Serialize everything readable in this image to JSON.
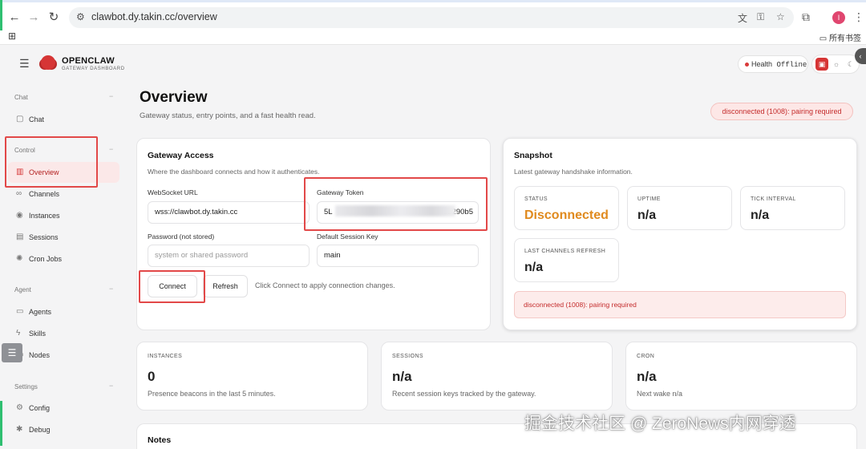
{
  "browser": {
    "url": "clawbot.dy.takin.cc/overview",
    "bookmark_folder": "所有书签",
    "profile_initial": "I"
  },
  "header": {
    "brand": "OPENCLAW",
    "brand_sub": "GATEWAY DASHBOARD",
    "health_label": "Health",
    "health_value": "Offline"
  },
  "sidebar": {
    "groups": [
      {
        "label": "Chat",
        "items": [
          {
            "label": "Chat",
            "icon": "chat-bubble-icon"
          }
        ]
      },
      {
        "label": "Control",
        "items": [
          {
            "label": "Overview",
            "icon": "bar-chart-icon",
            "active": true
          },
          {
            "label": "Channels",
            "icon": "link-icon"
          },
          {
            "label": "Instances",
            "icon": "radio-icon"
          },
          {
            "label": "Sessions",
            "icon": "document-icon"
          },
          {
            "label": "Cron Jobs",
            "icon": "loader-icon"
          }
        ]
      },
      {
        "label": "Agent",
        "items": [
          {
            "label": "Agents",
            "icon": "folder-icon"
          },
          {
            "label": "Skills",
            "icon": "bolt-icon"
          },
          {
            "label": "Nodes",
            "icon": "monitor-icon"
          }
        ]
      },
      {
        "label": "Settings",
        "items": [
          {
            "label": "Config",
            "icon": "gear-icon"
          },
          {
            "label": "Debug",
            "icon": "bug-icon"
          }
        ]
      }
    ]
  },
  "page": {
    "title": "Overview",
    "subtitle": "Gateway status, entry points, and a fast health read.",
    "status_pill": "disconnected (1008): pairing required"
  },
  "gateway": {
    "title": "Gateway Access",
    "subtitle": "Where the dashboard connects and how it authenticates.",
    "ws_label": "WebSocket URL",
    "ws_value": "wss://clawbot.dy.takin.cc",
    "token_label": "Gateway Token",
    "token_prefix": "5L",
    "token_suffix": "52290b5",
    "password_label": "Password (not stored)",
    "password_placeholder": "system or shared password",
    "session_key_label": "Default Session Key",
    "session_key_value": "main",
    "connect_label": "Connect",
    "refresh_label": "Refresh",
    "hint": "Click Connect to apply connection changes."
  },
  "snapshot": {
    "title": "Snapshot",
    "subtitle": "Latest gateway handshake information.",
    "status_label": "STATUS",
    "status_value": "Disconnected",
    "uptime_label": "UPTIME",
    "uptime_value": "n/a",
    "tick_label": "TICK INTERVAL",
    "tick_value": "n/a",
    "refresh_label": "LAST CHANNELS REFRESH",
    "refresh_value": "n/a",
    "error": "disconnected (1008): pairing required",
    "warn_color": "#e08a1e"
  },
  "stats": {
    "instances": {
      "label": "INSTANCES",
      "value": "0",
      "desc": "Presence beacons in the last 5 minutes."
    },
    "sessions": {
      "label": "SESSIONS",
      "value": "n/a",
      "desc": "Recent session keys tracked by the gateway."
    },
    "cron": {
      "label": "CRON",
      "value": "n/a",
      "desc": "Next wake n/a"
    }
  },
  "notes": {
    "title": "Notes"
  },
  "watermark": "掘金技术社区 @ ZeroNews内网穿透",
  "accent_color": "#d63535",
  "annotation_color": "#e24848"
}
